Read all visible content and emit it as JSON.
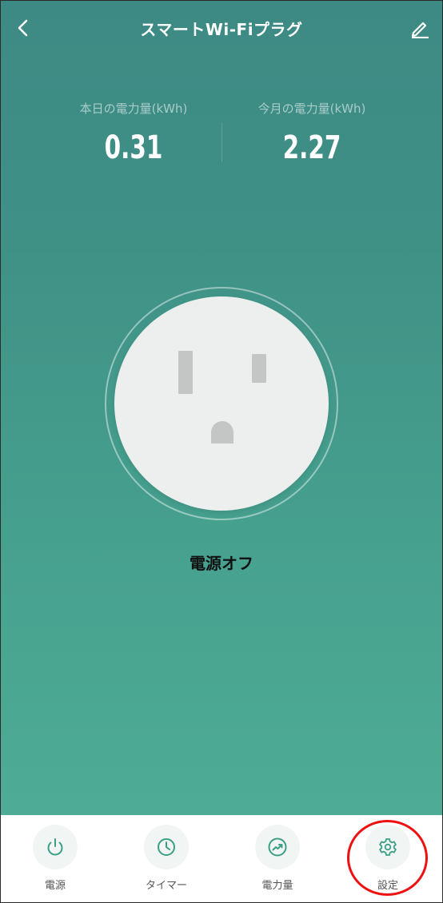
{
  "header": {
    "title": "スマートWi-Fiプラグ",
    "back_icon": "chevron-left-icon",
    "edit_icon": "pencil-icon"
  },
  "stats": {
    "today": {
      "label": "本日の電力量(kWh)",
      "value": "0.31"
    },
    "month": {
      "label": "今月の電力量(kWh)",
      "value": "2.27"
    }
  },
  "device": {
    "status": "電源オフ",
    "icon": "outlet-icon"
  },
  "bottom_nav": [
    {
      "label": "電源",
      "icon": "power-icon"
    },
    {
      "label": "タイマー",
      "icon": "clock-icon"
    },
    {
      "label": "電力量",
      "icon": "trend-icon"
    },
    {
      "label": "設定",
      "icon": "gear-icon"
    }
  ],
  "colors": {
    "accent": "#3b9f86",
    "background_top": "#3d8a84",
    "background_bottom": "#4eac94",
    "highlight": "#ee1111"
  }
}
